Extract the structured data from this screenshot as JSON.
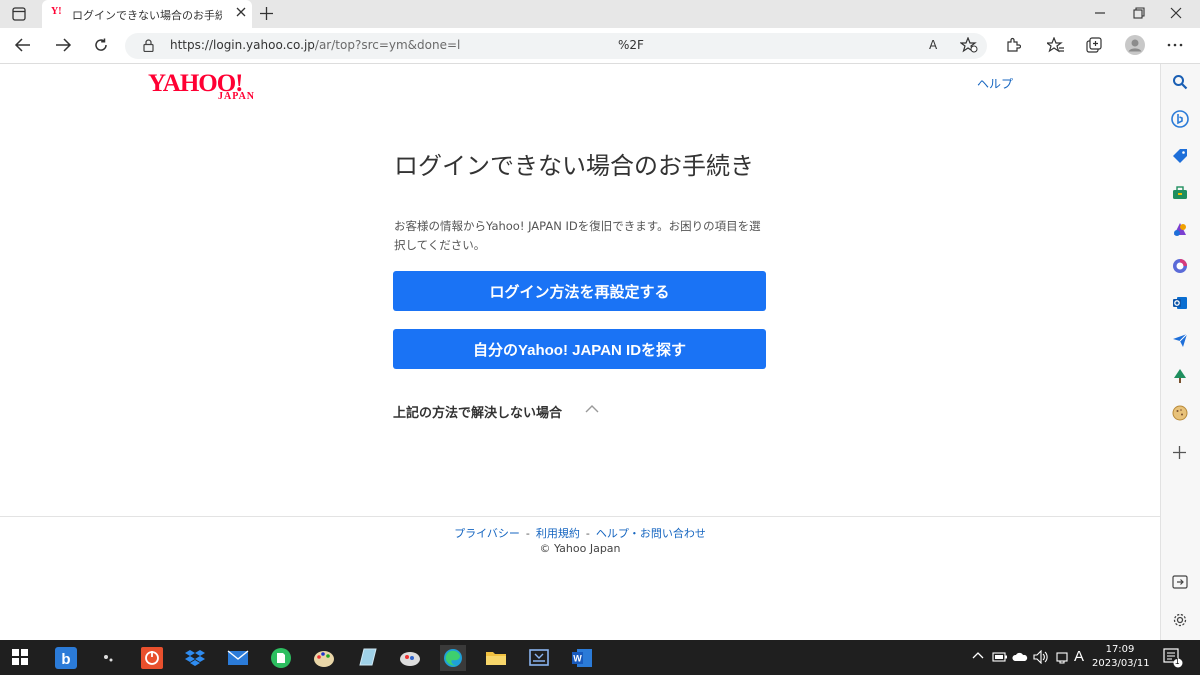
{
  "browser": {
    "tab_favicon": "Y!",
    "tab_title": "ログインできない場合のお手続き - Ya",
    "url_host": "https://login.yahoo.co.jp",
    "url_path": "/ar/top?src=ym&done=l",
    "url_suffix": "%2F",
    "reader_label": "A"
  },
  "page": {
    "logo_main": "YAHOO!",
    "logo_sub": "JAPAN",
    "help_link": "ヘルプ",
    "heading": "ログインできない場合のお手続き",
    "description": "お客様の情報からYahoo! JAPAN IDを復旧できます。お困りの項目を選択してください。",
    "button_reset_login": "ログイン方法を再設定する",
    "button_find_id": "自分のYahoo! JAPAN IDを探す",
    "collapse_label": "上記の方法で解決しない場合"
  },
  "footer": {
    "links": [
      "プライバシー",
      "利用規約",
      "ヘルプ・お問い合わせ"
    ],
    "separator": "-",
    "copyright": "© Yahoo Japan"
  },
  "taskbar": {
    "time": "17:09",
    "date": "2023/03/11",
    "ime": "A",
    "notification_count": "1"
  },
  "colors": {
    "brand_red": "#ff0033",
    "primary_button": "#1a73f5",
    "link_blue": "#1565c0"
  },
  "icons": {
    "sidebar": [
      "search-icon",
      "bing-chat-icon",
      "shopping-tag-icon",
      "tools-icon",
      "games-icon",
      "office-icon",
      "outlook-icon",
      "send-icon",
      "tree-icon",
      "cookie-icon",
      "add-icon"
    ],
    "taskbar": [
      "bing-icon",
      "app-icon",
      "power-app-icon",
      "dropbox-icon",
      "mail-icon",
      "evernote-icon",
      "paint-icon",
      "notepad-icon",
      "photo-icon",
      "edge-icon",
      "file-explorer-icon",
      "scanner-icon",
      "word-icon"
    ]
  }
}
